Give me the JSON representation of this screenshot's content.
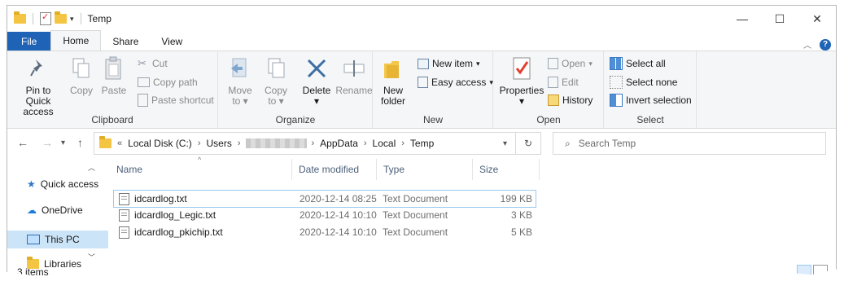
{
  "window": {
    "title": "Temp",
    "controls": {
      "minimize": "—",
      "maximize": "☐",
      "close": "✕"
    }
  },
  "tabs": {
    "file": "File",
    "home": "Home",
    "share": "Share",
    "view": "View"
  },
  "ribbon": {
    "clipboard": {
      "title": "Clipboard",
      "pin_line1": "Pin to Quick",
      "pin_line2": "access",
      "copy": "Copy",
      "paste": "Paste",
      "cut": "Cut",
      "copy_path": "Copy path",
      "paste_shortcut": "Paste shortcut"
    },
    "organize": {
      "title": "Organize",
      "move_to_1": "Move",
      "move_to_2": "to",
      "copy_to_1": "Copy",
      "copy_to_2": "to",
      "delete": "Delete",
      "rename": "Rename"
    },
    "new": {
      "title": "New",
      "new_folder_1": "New",
      "new_folder_2": "folder",
      "new_item": "New item",
      "easy_access": "Easy access"
    },
    "open": {
      "title": "Open",
      "properties": "Properties",
      "open": "Open",
      "edit": "Edit",
      "history": "History"
    },
    "select": {
      "title": "Select",
      "select_all": "Select all",
      "select_none": "Select none",
      "invert": "Invert selection"
    }
  },
  "address": {
    "prefix": "«",
    "segments": [
      "Local Disk (C:)",
      "Users",
      "AppData",
      "Local",
      "Temp"
    ],
    "search_placeholder": "Search Temp"
  },
  "nav_pane": {
    "items": [
      {
        "label": "Quick access",
        "icon": "star-icon"
      },
      {
        "label": "OneDrive",
        "icon": "cloud-icon"
      },
      {
        "label": "This PC",
        "icon": "monitor-icon"
      },
      {
        "label": "Libraries",
        "icon": "folder-icon"
      }
    ]
  },
  "file_list": {
    "columns": [
      "Name",
      "Date modified",
      "Type",
      "Size"
    ],
    "rows": [
      {
        "name": "idcardlog.txt",
        "date": "2020-12-14 08:25",
        "type": "Text Document",
        "size": "199 KB"
      },
      {
        "name": "idcardlog_Legic.txt",
        "date": "2020-12-14 10:10",
        "type": "Text Document",
        "size": "3 KB"
      },
      {
        "name": "idcardlog_pkichip.txt",
        "date": "2020-12-14 10:10",
        "type": "Text Document",
        "size": "5 KB"
      }
    ]
  },
  "status": {
    "items": "3 items"
  },
  "colors": {
    "accent": "#1e63b5",
    "selection": "#cce4f7",
    "ribbon_bg": "#f5f6f7"
  }
}
